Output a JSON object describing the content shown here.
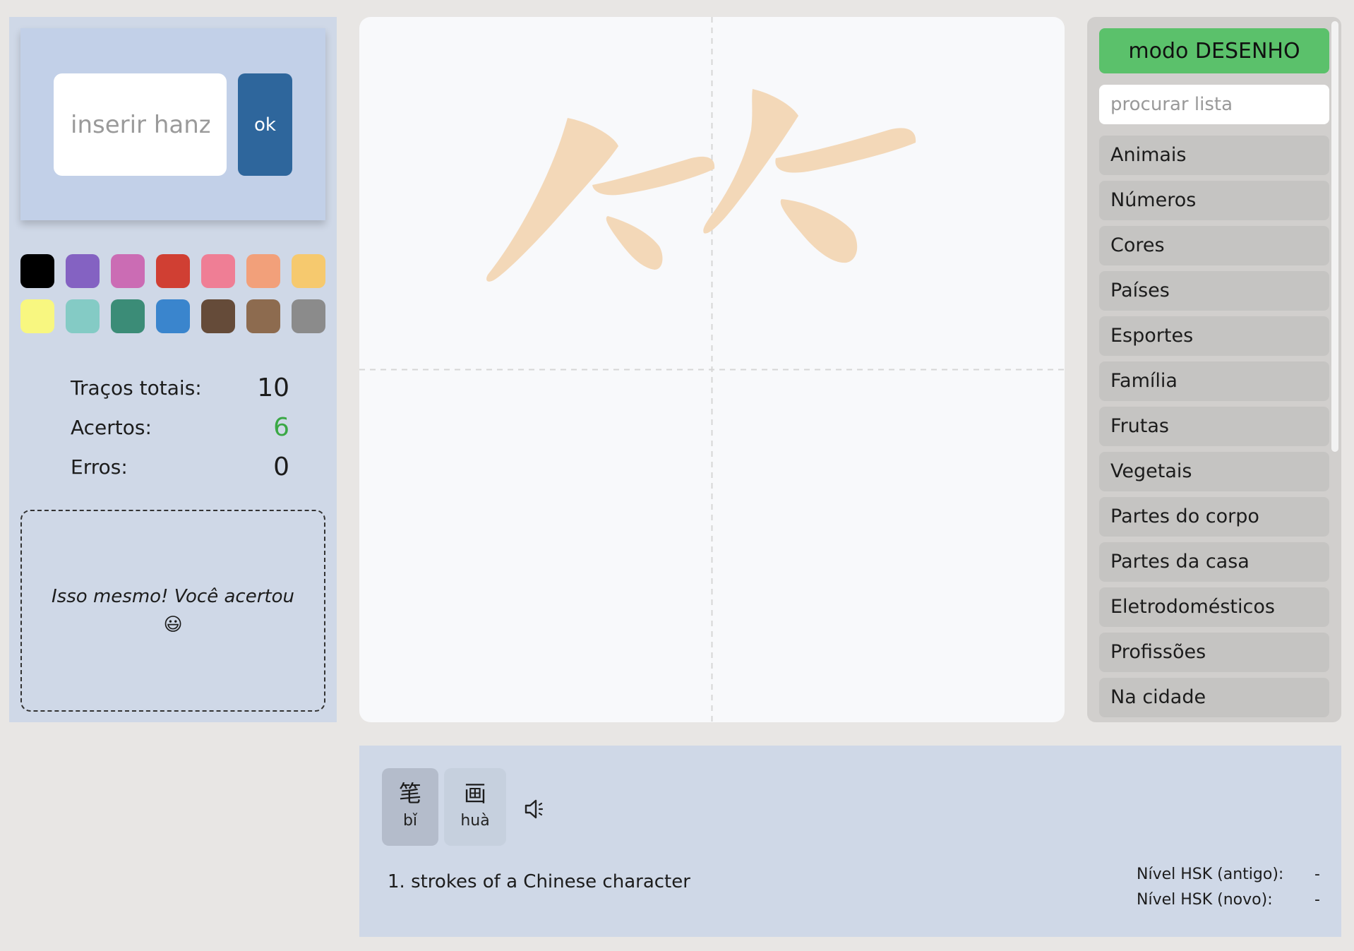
{
  "input": {
    "placeholder": "inserir hanzi",
    "ok_label": "ok"
  },
  "palette": [
    "#000000",
    "#8462c2",
    "#cb6cb4",
    "#d03f33",
    "#ef7e95",
    "#f2a07a",
    "#f6c96e",
    "#f8f780",
    "#84cbc5",
    "#3b8c77",
    "#3a85cd",
    "#654b39",
    "#8d6b4f",
    "#8b8b8b"
  ],
  "stats": {
    "total_label": "Traços totais:",
    "total_value": "10",
    "correct_label": "Acertos:",
    "correct_value": "6",
    "correct_color": "#3aa845",
    "errors_label": "Erros:",
    "errors_value": "0"
  },
  "feedback": {
    "message": "Isso mesmo! Você acertou",
    "emoji": "😃"
  },
  "canvas": {
    "stroke_color": "#f3d8b8"
  },
  "right_panel": {
    "mode_label": "modo DESENHO",
    "search_placeholder": "procurar lista",
    "categories": [
      "Animais",
      "Números",
      "Cores",
      "Países",
      "Esportes",
      "Família",
      "Frutas",
      "Vegetais",
      "Partes do corpo",
      "Partes da casa",
      "Eletrodomésticos",
      "Profissões",
      "Na cidade"
    ]
  },
  "info": {
    "characters": [
      {
        "hanzi": "笔",
        "pinyin": "bǐ",
        "active": true
      },
      {
        "hanzi": "画",
        "pinyin": "huà",
        "active": false
      }
    ],
    "speaker_icon": "speaker-icon",
    "definition": "1. strokes of a Chinese character",
    "hsk_old_label": "Nível HSK (antigo):",
    "hsk_old_value": "-",
    "hsk_new_label": "Nível HSK (novo):",
    "hsk_new_value": "-"
  }
}
